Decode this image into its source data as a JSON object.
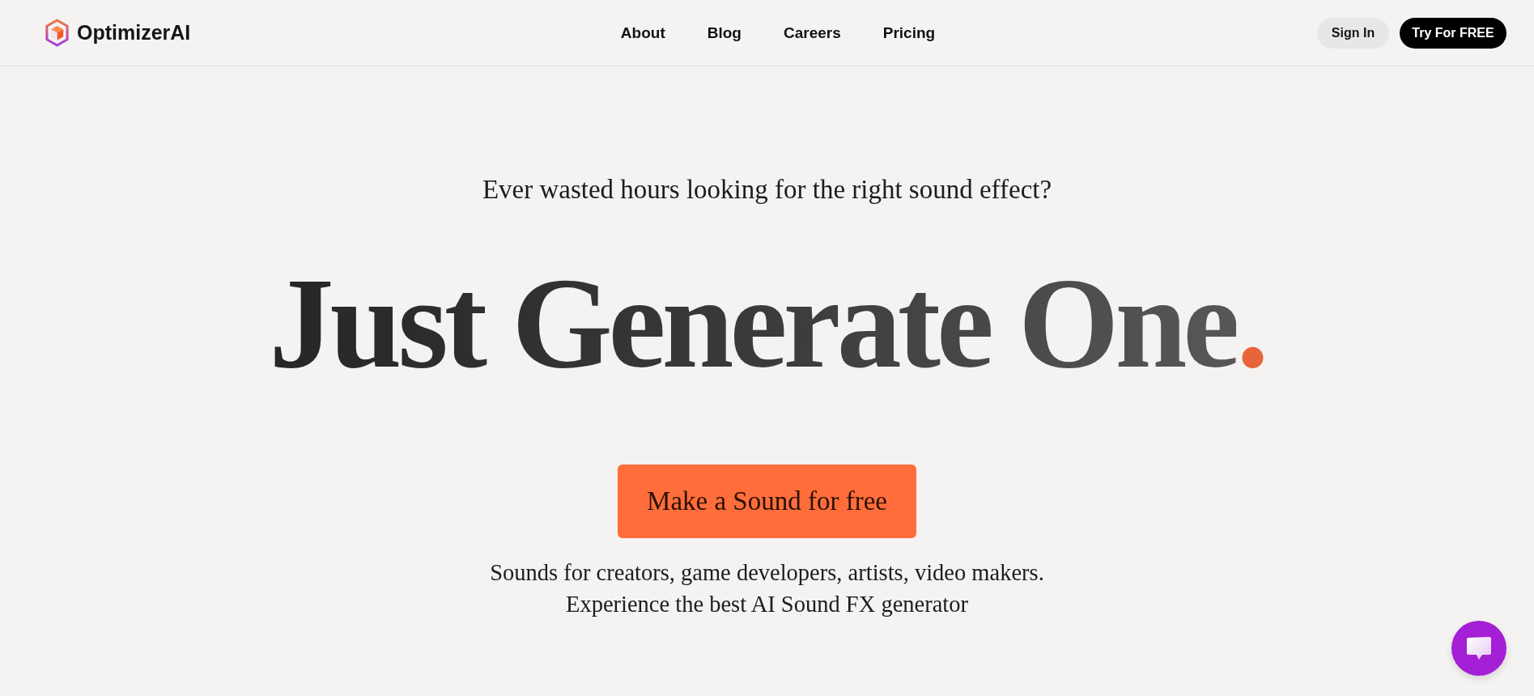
{
  "header": {
    "brand": "OptimizerAI",
    "nav": [
      "About",
      "Blog",
      "Careers",
      "Pricing"
    ],
    "actions": [
      {
        "label": "Sign In",
        "kind": "secondary"
      },
      {
        "label": "Try For FREE",
        "kind": "primary"
      }
    ]
  },
  "hero": {
    "eyebrow": "Ever wasted hours looking for the right sound effect?",
    "headline": "Just Generate One",
    "headline_mark": ".",
    "cta": "Make a Sound for free",
    "tagline": [
      "Sounds for creators, game developers, artists, video makers.",
      "Experience the best AI Sound FX generator"
    ]
  }
}
